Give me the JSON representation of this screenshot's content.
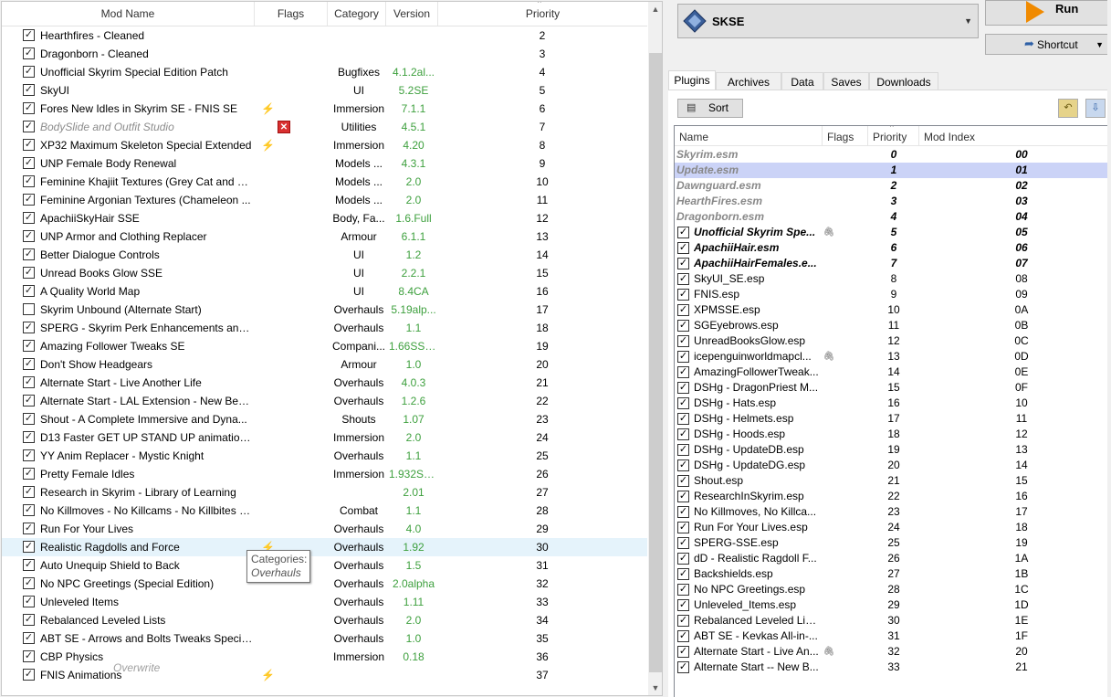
{
  "mods": {
    "columns": {
      "name": "Mod Name",
      "flags": "Flags",
      "category": "Category",
      "version": "Version",
      "priority": "Priority"
    },
    "rows": [
      {
        "checked": true,
        "name": "Hearthfires - Cleaned",
        "category": "",
        "version": "",
        "priority": "2"
      },
      {
        "checked": true,
        "name": "Dragonborn - Cleaned",
        "category": "",
        "version": "",
        "priority": "3"
      },
      {
        "checked": true,
        "name": "Unofficial Skyrim Special Edition Patch",
        "category": "Bugfixes",
        "version": "4.1.2al...",
        "priority": "4"
      },
      {
        "checked": true,
        "name": "SkyUI",
        "category": "UI",
        "version": "5.2SE",
        "priority": "5"
      },
      {
        "checked": true,
        "name": "Fores New Idles in Skyrim SE - FNIS SE",
        "flag": "lightning-icon",
        "category": "Immersion",
        "version": "7.1.1",
        "priority": "6"
      },
      {
        "checked": true,
        "name": "BodySlide and Outfit Studio",
        "disabled": true,
        "flag": "conflict-icon",
        "category": "Utilities",
        "version": "4.5.1",
        "priority": "7"
      },
      {
        "checked": true,
        "name": "XP32 Maximum Skeleton Special Extended",
        "flag": "lightning-icon",
        "category": "Immersion",
        "version": "4.20",
        "priority": "8"
      },
      {
        "checked": true,
        "name": "UNP Female Body Renewal",
        "category": "Models ...",
        "version": "4.3.1",
        "priority": "9"
      },
      {
        "checked": true,
        "name": "Feminine Khajiit Textures (Grey Cat and Le...",
        "category": "Models ...",
        "version": "2.0",
        "priority": "10"
      },
      {
        "checked": true,
        "name": "Feminine Argonian Textures (Chameleon ...",
        "category": "Models ...",
        "version": "2.0",
        "priority": "11"
      },
      {
        "checked": true,
        "name": "ApachiiSkyHair SSE",
        "category": "Body, Fa...",
        "version": "1.6.Full",
        "priority": "12"
      },
      {
        "checked": true,
        "name": "UNP Armor and Clothing Replacer",
        "category": "Armour",
        "version": "6.1.1",
        "priority": "13"
      },
      {
        "checked": true,
        "name": "Better Dialogue Controls",
        "category": "UI",
        "version": "1.2",
        "priority": "14"
      },
      {
        "checked": true,
        "name": "Unread Books Glow SSE",
        "category": "UI",
        "version": "2.2.1",
        "priority": "15"
      },
      {
        "checked": true,
        "name": "A Quality World Map",
        "category": "UI",
        "version": "8.4CA",
        "priority": "16"
      },
      {
        "checked": false,
        "name": "Skyrim Unbound (Alternate Start)",
        "category": "Overhauls",
        "version": "5.19alp...",
        "priority": "17"
      },
      {
        "checked": true,
        "name": "SPERG - Skyrim Perk Enhancements and R...",
        "category": "Overhauls",
        "version": "1.1",
        "priority": "18"
      },
      {
        "checked": true,
        "name": "Amazing Follower Tweaks SE",
        "category": "Compani...",
        "version": "1.66SSE...",
        "priority": "19"
      },
      {
        "checked": true,
        "name": "Don't Show Headgears",
        "category": "Armour",
        "version": "1.0",
        "priority": "20"
      },
      {
        "checked": true,
        "name": "Alternate Start - Live Another Life",
        "category": "Overhauls",
        "version": "4.0.3",
        "priority": "21"
      },
      {
        "checked": true,
        "name": "Alternate Start - LAL Extension - New Begi...",
        "category": "Overhauls",
        "version": "1.2.6",
        "priority": "22"
      },
      {
        "checked": true,
        "name": "Shout - A Complete Immersive and Dyna...",
        "category": "Shouts",
        "version": "1.07",
        "priority": "23"
      },
      {
        "checked": true,
        "name": "D13 Faster GET UP STAND UP animation v...",
        "category": "Immersion",
        "version": "2.0",
        "priority": "24"
      },
      {
        "checked": true,
        "name": "YY Anim Replacer - Mystic Knight",
        "category": "Overhauls",
        "version": "1.1",
        "priority": "25"
      },
      {
        "checked": true,
        "name": "Pretty Female Idles",
        "category": "Immersion",
        "version": "1.932SSE",
        "priority": "26"
      },
      {
        "checked": true,
        "name": "Research in Skyrim - Library of Learning",
        "category": "",
        "version": "2.01",
        "priority": "27"
      },
      {
        "checked": true,
        "name": "No Killmoves - No Killcams - No Killbites SE",
        "category": "Combat",
        "version": "1.1",
        "priority": "28"
      },
      {
        "checked": true,
        "name": "Run For Your Lives",
        "category": "Overhauls",
        "version": "4.0",
        "priority": "29"
      },
      {
        "checked": true,
        "name": "Realistic Ragdolls and Force",
        "highlight": true,
        "flag": "lightning-icon",
        "category": "Overhauls",
        "version": "1.92",
        "priority": "30"
      },
      {
        "checked": true,
        "name": "Auto Unequip Shield to Back",
        "category": "Overhauls",
        "version": "1.5",
        "priority": "31"
      },
      {
        "checked": true,
        "name": "No NPC Greetings (Special Edition)",
        "category": "Overhauls",
        "version": "2.0alpha",
        "priority": "32"
      },
      {
        "checked": true,
        "name": "Unleveled Items",
        "category": "Overhauls",
        "version": "1.11",
        "priority": "33"
      },
      {
        "checked": true,
        "name": "Rebalanced Leveled Lists",
        "category": "Overhauls",
        "version": "2.0",
        "priority": "34"
      },
      {
        "checked": true,
        "name": "ABT SE - Arrows and Bolts Tweaks Special ...",
        "category": "Overhauls",
        "version": "1.0",
        "priority": "35"
      },
      {
        "checked": true,
        "name": "CBP Physics",
        "category": "Immersion",
        "version": "0.18",
        "priority": "36"
      },
      {
        "checked": true,
        "name": "FNIS Animations",
        "flag": "lightning-icon",
        "category": "",
        "version": "",
        "priority": "37"
      }
    ],
    "overwrite_label": "Overwrite",
    "tooltip": {
      "title": "Categories:",
      "value": "Overhauls"
    }
  },
  "executable": {
    "selected": "SKSE",
    "icon": "skse-icon"
  },
  "run_label": "Run",
  "shortcut_label": "Shortcut",
  "tabs": [
    "Plugins",
    "Archives",
    "Data",
    "Saves",
    "Downloads"
  ],
  "active_tab": "Plugins",
  "sort_label": "Sort",
  "plugins": {
    "columns": {
      "name": "Name",
      "flags": "Flags",
      "priority": "Priority",
      "index": "Mod Index"
    },
    "rows": [
      {
        "type": "master",
        "name": "Skyrim.esm",
        "priority": "0",
        "index": "00"
      },
      {
        "type": "master",
        "name": "Update.esm",
        "priority": "1",
        "index": "01",
        "selected": true
      },
      {
        "type": "master",
        "name": "Dawnguard.esm",
        "priority": "2",
        "index": "02"
      },
      {
        "type": "master",
        "name": "HearthFires.esm",
        "priority": "3",
        "index": "03"
      },
      {
        "type": "master",
        "name": "Dragonborn.esm",
        "priority": "4",
        "index": "04"
      },
      {
        "type": "bold",
        "name": "Unofficial Skyrim Spe...",
        "flag": "attachment-icon",
        "priority": "5",
        "index": "05"
      },
      {
        "type": "bold",
        "name": "ApachiiHair.esm",
        "priority": "6",
        "index": "06"
      },
      {
        "type": "bold",
        "name": "ApachiiHairFemales.e...",
        "priority": "7",
        "index": "07"
      },
      {
        "type": "normal",
        "name": "SkyUI_SE.esp",
        "priority": "8",
        "index": "08"
      },
      {
        "type": "normal",
        "name": "FNIS.esp",
        "priority": "9",
        "index": "09"
      },
      {
        "type": "normal",
        "name": "XPMSSE.esp",
        "priority": "10",
        "index": "0A"
      },
      {
        "type": "normal",
        "name": "SGEyebrows.esp",
        "priority": "11",
        "index": "0B"
      },
      {
        "type": "normal",
        "name": "UnreadBooksGlow.esp",
        "priority": "12",
        "index": "0C"
      },
      {
        "type": "normal",
        "name": "icepenguinworldmapcl...",
        "flag": "attachment-icon",
        "priority": "13",
        "index": "0D"
      },
      {
        "type": "normal",
        "name": "AmazingFollowerTweak...",
        "priority": "14",
        "index": "0E"
      },
      {
        "type": "normal",
        "name": "DSHg - DragonPriest M...",
        "priority": "15",
        "index": "0F"
      },
      {
        "type": "normal",
        "name": "DSHg - Hats.esp",
        "priority": "16",
        "index": "10"
      },
      {
        "type": "normal",
        "name": "DSHg - Helmets.esp",
        "priority": "17",
        "index": "11"
      },
      {
        "type": "normal",
        "name": "DSHg - Hoods.esp",
        "priority": "18",
        "index": "12"
      },
      {
        "type": "normal",
        "name": "DSHg - UpdateDB.esp",
        "priority": "19",
        "index": "13"
      },
      {
        "type": "normal",
        "name": "DSHg - UpdateDG.esp",
        "priority": "20",
        "index": "14"
      },
      {
        "type": "normal",
        "name": "Shout.esp",
        "priority": "21",
        "index": "15"
      },
      {
        "type": "normal",
        "name": "ResearchInSkyrim.esp",
        "priority": "22",
        "index": "16"
      },
      {
        "type": "normal",
        "name": "No Killmoves, No Killca...",
        "priority": "23",
        "index": "17"
      },
      {
        "type": "normal",
        "name": "Run For Your Lives.esp",
        "priority": "24",
        "index": "18"
      },
      {
        "type": "normal",
        "name": "SPERG-SSE.esp",
        "priority": "25",
        "index": "19"
      },
      {
        "type": "normal",
        "name": "dD - Realistic Ragdoll F...",
        "priority": "26",
        "index": "1A"
      },
      {
        "type": "normal",
        "name": "Backshields.esp",
        "priority": "27",
        "index": "1B"
      },
      {
        "type": "normal",
        "name": "No NPC Greetings.esp",
        "priority": "28",
        "index": "1C"
      },
      {
        "type": "normal",
        "name": "Unleveled_Items.esp",
        "priority": "29",
        "index": "1D"
      },
      {
        "type": "normal",
        "name": "Rebalanced Leveled List...",
        "priority": "30",
        "index": "1E"
      },
      {
        "type": "normal",
        "name": "ABT SE - Kevkas All-in-...",
        "priority": "31",
        "index": "1F"
      },
      {
        "type": "normal",
        "name": "Alternate Start - Live An...",
        "flag": "attachment-icon",
        "priority": "32",
        "index": "20"
      },
      {
        "type": "normal",
        "name": "Alternate Start -- New B...",
        "priority": "33",
        "index": "21"
      }
    ]
  },
  "colors": {
    "version": "#3ea03e",
    "selection": "#cbd3f7",
    "hover": "#e5f3fb",
    "run_icon": "#f08a00"
  }
}
